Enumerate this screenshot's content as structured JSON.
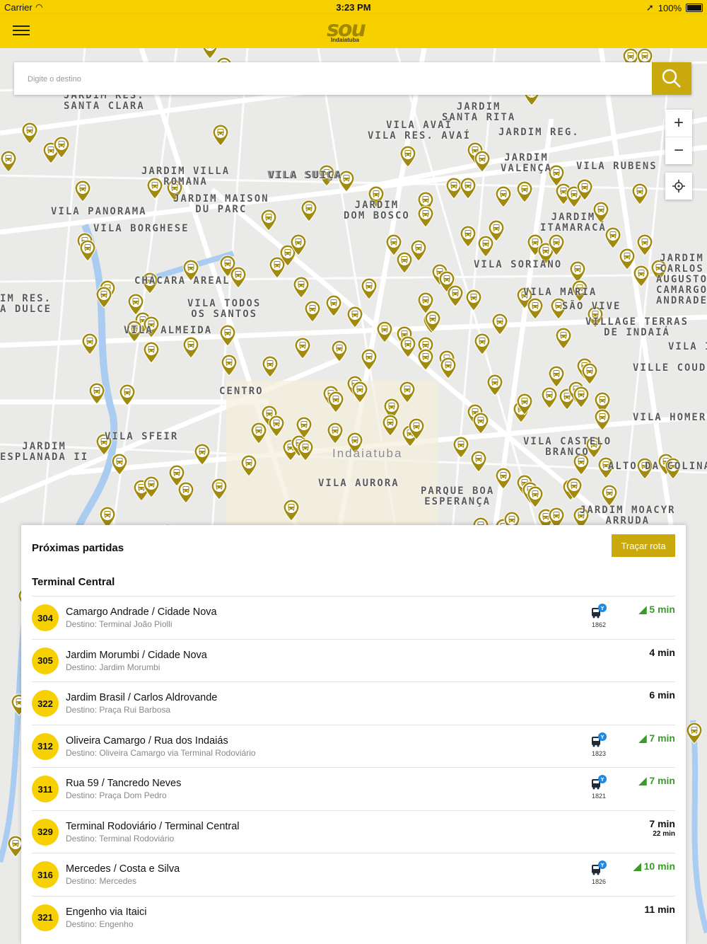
{
  "status_bar": {
    "carrier": "Carrier",
    "time": "3:23 PM",
    "battery": "100%"
  },
  "header": {
    "logo_text": "sou",
    "logo_subtext": "Indaiatuba"
  },
  "search": {
    "placeholder": "Digite o destino"
  },
  "map": {
    "zoom_in": "+",
    "zoom_out": "−",
    "area_labels": [
      {
        "text": "JARDIM RES.\nSANTA CLARA"
      },
      {
        "text": "VILA AVAÍ\nVILA RES. AVAÍ"
      },
      {
        "text": "JARDIM\nSANTA RITA"
      },
      {
        "text": "JARDIM REG."
      },
      {
        "text": "VILA RUBENS"
      },
      {
        "text": "JARDIM\nVALENÇA"
      },
      {
        "text": "JARDIM VILLA\nROMANA"
      },
      {
        "text": "VILA SUIÇA"
      },
      {
        "text": "JARDIM MAISON\nDU PARC"
      },
      {
        "text": "VILA PANORAMA"
      },
      {
        "text": "VILA BORGHESE"
      },
      {
        "text": "JARDIM\nDOM BOSCO"
      },
      {
        "text": "JARDIM\nITAMARACÁ"
      },
      {
        "text": "VILA SORIANO"
      },
      {
        "text": "CHÁCARA AREAL"
      },
      {
        "text": "VILA TODOS\nOS SANTOS"
      },
      {
        "text": "VILA ALMEIDA"
      },
      {
        "text": "VILA MARIA"
      },
      {
        "text": "SÃO VIVE"
      },
      {
        "text": "VILLAGE TERRAS\nDE INDAIÁ"
      },
      {
        "text": "CENTRO"
      },
      {
        "text": "VILA SFEIR"
      },
      {
        "text": "JARDIM\nESPLANADA II"
      },
      {
        "text": "VILA AURORA"
      },
      {
        "text": "PARQUE BOA\nESPERANÇA"
      },
      {
        "text": "VILA CASTELO\nBRANCO"
      },
      {
        "text": "ALTO DA COLINA"
      },
      {
        "text": "JARDIM MOACYR\nARRUDA"
      },
      {
        "text": "VILLE COUDE"
      },
      {
        "text": "VILA HOMERO"
      },
      {
        "text": "Indaiatuba"
      },
      {
        "text": "JARDIM\nCARLOS\nAUGUSTO\nCAMARGO\nANDRADE"
      },
      {
        "text": "IM RES.\nA DULCE"
      },
      {
        "text": "VILA IN"
      },
      {
        "text": "VILA SUIÇA"
      }
    ]
  },
  "panel": {
    "title": "Próximas partidas",
    "route_button": "Traçar rota",
    "terminal": "Terminal Central",
    "departures": [
      {
        "line": "304",
        "name": "Camargo Andrade / Cidade Nova",
        "destination": "Destino: Terminal João Piolli",
        "bus": "1862",
        "eta": "5 min",
        "live": true,
        "next": ""
      },
      {
        "line": "305",
        "name": "Jardim Morumbi / Cidade Nova",
        "destination": "Destino: Jardim Morumbi",
        "bus": "",
        "eta": "4 min",
        "live": false,
        "next": ""
      },
      {
        "line": "322",
        "name": "Jardim Brasil / Carlos Aldrovande",
        "destination": "Destino: Praça Rui Barbosa",
        "bus": "",
        "eta": "6 min",
        "live": false,
        "next": ""
      },
      {
        "line": "312",
        "name": "Oliveira Camargo / Rua dos Indaiás",
        "destination": "Destino: Oliveira Camargo via Terminal Rodoviário",
        "bus": "1823",
        "eta": "7 min",
        "live": true,
        "next": ""
      },
      {
        "line": "311",
        "name": "Rua 59 / Tancredo Neves",
        "destination": "Destino: Praça Dom Pedro",
        "bus": "1821",
        "eta": "7 min",
        "live": true,
        "next": ""
      },
      {
        "line": "329",
        "name": "Terminal Rodoviário / Terminal Central",
        "destination": "Destino: Terminal Rodoviário",
        "bus": "",
        "eta": "7 min",
        "live": false,
        "next": "22 min"
      },
      {
        "line": "316",
        "name": "Mercedes / Costa e Silva",
        "destination": "Destino: Mercedes",
        "bus": "1826",
        "eta": "10 min",
        "live": true,
        "next": ""
      },
      {
        "line": "321",
        "name": "Engenho via Itaici",
        "destination": "Destino: Engenho",
        "bus": "",
        "eta": "11 min",
        "live": false,
        "next": ""
      }
    ]
  },
  "colors": {
    "brand_yellow": "#f7d000",
    "pin_gold": "#a08a10",
    "live_green": "#3a9a2a"
  }
}
